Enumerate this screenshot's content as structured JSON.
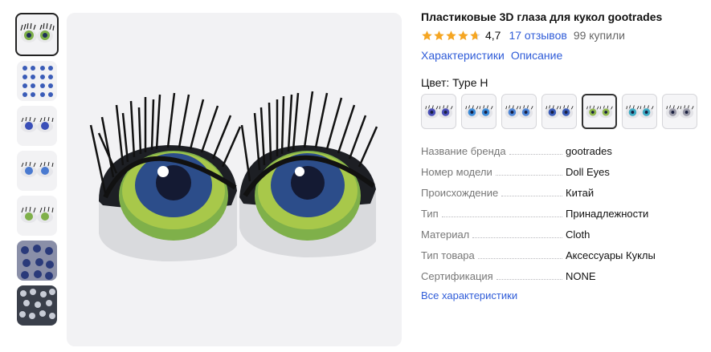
{
  "product": {
    "title": "Пластиковые 3D глаза для кукол gootrades",
    "rating_value": "4,7",
    "stars": 4.7,
    "reviews_link": "17 отзывов",
    "sold_text": "99 купили"
  },
  "nav": {
    "characteristics_link": "Характеристики",
    "description_link": "Описание"
  },
  "color": {
    "label": "Цвет: Type H",
    "options": [
      {
        "iris": "#4a4fb8"
      },
      {
        "iris": "#3a8ad8"
      },
      {
        "iris": "#4c84d6"
      },
      {
        "iris": "#3a5cb8"
      },
      {
        "iris": "#8fb84a"
      },
      {
        "iris": "#3cabc4"
      },
      {
        "iris": "#9a9aa8"
      }
    ],
    "selected_index": 4
  },
  "specs": [
    {
      "key": "Название бренда",
      "value": "gootrades"
    },
    {
      "key": "Номер модели",
      "value": "Doll Eyes"
    },
    {
      "key": "Происхождение",
      "value": "Китай"
    },
    {
      "key": "Тип",
      "value": "Принадлежности"
    },
    {
      "key": "Материал",
      "value": "Cloth"
    },
    {
      "key": "Тип товара",
      "value": "Аксессуары Куклы"
    },
    {
      "key": "Сертификация",
      "value": "NONE"
    }
  ],
  "all_specs_link": "Все характеристики",
  "colors": {
    "link": "#2f5cd8",
    "star": "#f5a623",
    "muted": "#777777"
  }
}
